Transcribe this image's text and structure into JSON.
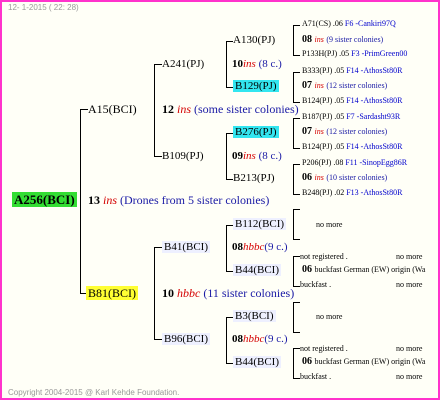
{
  "header": "12- 1-2015 ( 22: 28)",
  "footer": "Copyright 2004-2015 @ Karl Kehde Foundation.",
  "root": {
    "name": "A256(BCI)",
    "gen": "13",
    "marker": "ins",
    "note": "(Drones from 5 sister colonies)"
  },
  "A15": {
    "name": "A15(BCI)",
    "gen": "12",
    "marker": "ins",
    "note": "(some sister colonies)"
  },
  "B81": {
    "name": "B81(BCI)",
    "gen": "10",
    "marker": "hbbc",
    "note": "(11 sister colonies)"
  },
  "A241": {
    "name": "A241(PJ)",
    "gen": "10",
    "marker": "ins",
    "note": "(8 c.)"
  },
  "B109": {
    "name": "B109(PJ)",
    "gen": "09",
    "marker": "ins",
    "note": "(8 c.)"
  },
  "B41": {
    "name": "B41(BCI)",
    "gen": "08",
    "marker": "hbbc",
    "note": "(9 c.)"
  },
  "B96": {
    "name": "B96(BCI)",
    "gen": "08",
    "marker": "hbbc",
    "note": "(9 c.)"
  },
  "A130": {
    "name": "A130(PJ)",
    "gen": "08",
    "marker": "ins",
    "note": "(9 sister colonies)"
  },
  "B129": {
    "name": "B129(PJ)",
    "gen": "07",
    "marker": "ins",
    "note": "(12 sister colonies)"
  },
  "B276": {
    "name": "B276(PJ)",
    "gen": "07",
    "marker": "ins",
    "note": "(12 sister colonies)"
  },
  "B213": {
    "name": "B213(PJ)",
    "gen": "06",
    "marker": "ins",
    "note": "(10 sister colonies)"
  },
  "B112": {
    "name": "B112(BCI)",
    "no_more": "no more"
  },
  "B44a": {
    "name": "B44(BCI)",
    "gen": "06",
    "line": "buckfast German (EW) origin (Wa"
  },
  "B3": {
    "name": "B3(BCI)",
    "no_more": "no more"
  },
  "B44b": {
    "name": "B44(BCI)",
    "gen": "06",
    "line": "buckfast German (EW) origin (Wa"
  },
  "l1": {
    "id": "A71(CS)",
    "pct": ".06",
    "ext": "F6 -Cankiri97Q"
  },
  "l2": {
    "id": "P133H(PJ)",
    "pct": ".05",
    "ext": "F3 -PrimGreen00"
  },
  "l3": {
    "id": "B333(PJ)",
    "pct": ".05",
    "ext": "F14 -AthosSt80R"
  },
  "l4": {
    "id": "B124(PJ)",
    "pct": ".05",
    "ext": "F14 -AthosSt80R"
  },
  "l5": {
    "id": "B187(PJ)",
    "pct": ".05",
    "ext": "F7 -Sardasht93R"
  },
  "l6": {
    "id": "B124(PJ)",
    "pct": ".05",
    "ext": "F14 -AthosSt80R"
  },
  "l7": {
    "id": "P206(PJ)",
    "pct": ".08",
    "ext": "F11 -SinopEgg86R"
  },
  "l8": {
    "id": "B248(PJ)",
    "pct": ".02",
    "ext": "F13 -AthosSt80R"
  },
  "nr1": {
    "label": "not registered .",
    "no_more": "no more"
  },
  "bf1": {
    "label": "buckfast .",
    "no_more": "no more"
  },
  "nr2": {
    "label": "not registered .",
    "no_more": "no more"
  },
  "bf2": {
    "label": "buckfast .",
    "no_more": "no more"
  },
  "colors": {
    "border": "#ff33cc",
    "green": "#33dd33",
    "yellow": "#ffff33",
    "cyan": "#33e6f0",
    "red": "#d40000",
    "blue": "#1a1aa5"
  }
}
